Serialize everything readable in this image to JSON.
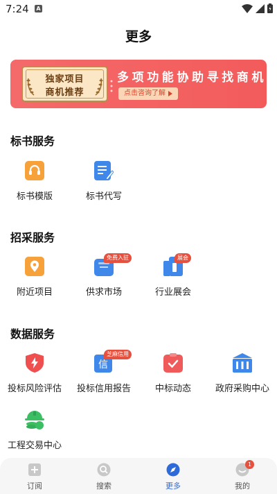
{
  "status_bar": {
    "time": "7:24",
    "notif_letter": "A"
  },
  "header": {
    "title": "更多"
  },
  "banner": {
    "badge_line1": "独家项目",
    "badge_line2": "商机推荐",
    "slogan": "多项功能协助寻找商机",
    "cta": "点击咨询了解"
  },
  "sections": {
    "bid_services": {
      "title": "标书服务",
      "items": [
        {
          "label": "标书模版",
          "icon": "headset-document-icon",
          "color": "#f6a13a"
        },
        {
          "label": "标书代写",
          "icon": "document-edit-icon",
          "color": "#3f88ea"
        }
      ]
    },
    "procurement_services": {
      "title": "招采服务",
      "items": [
        {
          "label": "附近项目",
          "icon": "location-pin-icon",
          "color": "#f6a13a"
        },
        {
          "label": "供求市场",
          "icon": "market-box-icon",
          "color": "#3f88ea",
          "badge": "免费入驻"
        },
        {
          "label": "行业展会",
          "icon": "exhibition-building-icon",
          "color": "#3f88ea",
          "badge": "展会"
        }
      ]
    },
    "data_services": {
      "title": "数据服务",
      "items": [
        {
          "label": "投标风险评估",
          "icon": "shield-lightning-icon",
          "color": "#ef4f4f"
        },
        {
          "label": "投标信用报告",
          "icon": "credit-report-icon",
          "color": "#3f88ea",
          "badge": "芝麻信用"
        },
        {
          "label": "中标动态",
          "icon": "check-clipboard-icon",
          "color": "#ef5b5b"
        },
        {
          "label": "政府采购中心",
          "icon": "government-building-icon",
          "color": "#3f88ea"
        },
        {
          "label": "工程交易中心",
          "icon": "hardhat-coins-icon",
          "color": "#3cbf63"
        }
      ]
    }
  },
  "bottom_nav": {
    "items": [
      {
        "label": "订阅",
        "icon": "subscribe-icon",
        "active": false
      },
      {
        "label": "搜索",
        "icon": "search-icon",
        "active": false
      },
      {
        "label": "更多",
        "icon": "compass-icon",
        "active": true
      },
      {
        "label": "我的",
        "icon": "profile-icon",
        "active": false,
        "badge": "1"
      }
    ]
  },
  "colors": {
    "accent": "#2f6bd8",
    "banner_red": "#f35b5b",
    "badge_red": "#e5503f"
  }
}
